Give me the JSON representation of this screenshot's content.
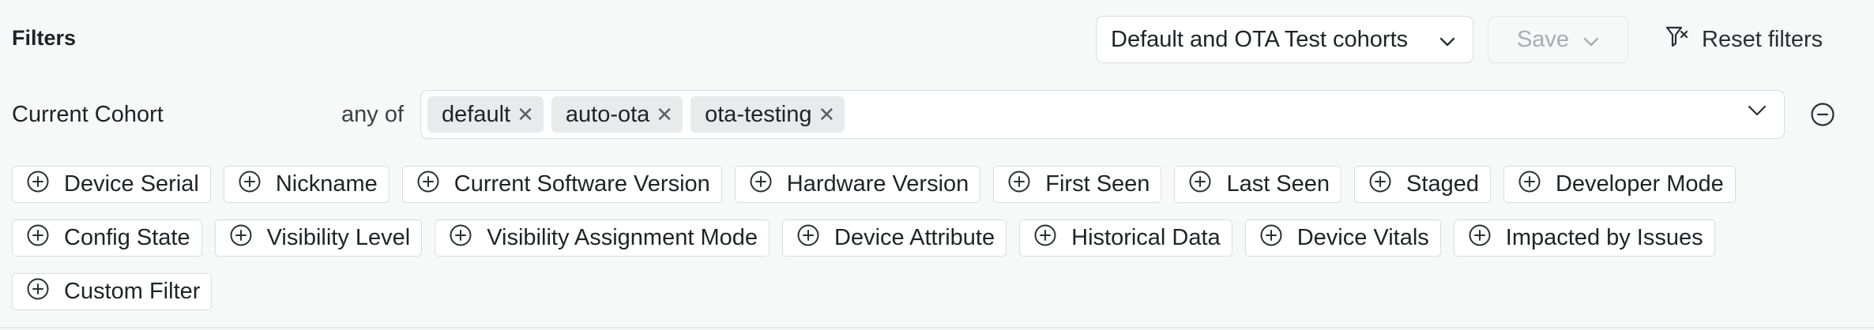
{
  "header": {
    "title": "Filters",
    "cohort_select_value": "Default and OTA Test cohorts",
    "save_label": "Save",
    "reset_label": "Reset filters"
  },
  "cohort_row": {
    "label": "Current Cohort",
    "operator": "any of",
    "tags": [
      "default",
      "auto-ota",
      "ota-testing"
    ]
  },
  "filter_chips": {
    "row1": [
      "Device Serial",
      "Nickname",
      "Current Software Version",
      "Hardware Version",
      "First Seen",
      "Last Seen",
      "Staged",
      "Developer Mode"
    ],
    "row2": [
      "Config State",
      "Visibility Level",
      "Visibility Assignment Mode",
      "Device Attribute",
      "Historical Data",
      "Device Vitals",
      "Impacted by Issues"
    ],
    "row3": [
      "Custom Filter"
    ]
  },
  "colors": {
    "background": "#f7f8f8",
    "border": "#d9dcdf",
    "tag_background": "#e8eaec",
    "disabled_text": "#a9aeb4"
  }
}
